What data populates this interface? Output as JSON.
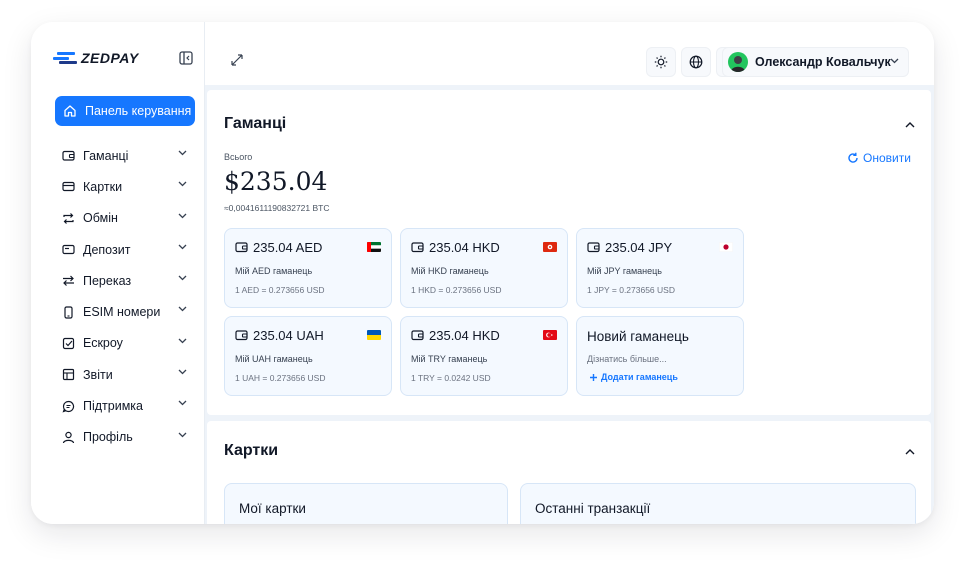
{
  "brand": {
    "name": "ZEDPAY"
  },
  "sidebar": {
    "dashboard_label": "Панель керування",
    "items": [
      {
        "label": "Гаманці",
        "icon": "wallet-icon"
      },
      {
        "label": "Картки",
        "icon": "card-icon"
      },
      {
        "label": "Обмін",
        "icon": "exchange-icon"
      },
      {
        "label": "Депозит",
        "icon": "deposit-icon"
      },
      {
        "label": "Переказ",
        "icon": "transfer-icon"
      },
      {
        "label": "ESIM номери",
        "icon": "esim-icon"
      },
      {
        "label": "Ескроу",
        "icon": "escrow-icon"
      },
      {
        "label": "Звіти",
        "icon": "reports-icon"
      },
      {
        "label": "Підтримка",
        "icon": "support-icon"
      },
      {
        "label": "Профіль",
        "icon": "profile-icon"
      }
    ]
  },
  "header": {
    "user_name": "Олександр Ковальчук"
  },
  "wallets": {
    "title": "Гаманці",
    "total_label": "Всього",
    "total_value": "$235.04",
    "total_btc": "≈0,004161119083272​1 BTC",
    "refresh_label": "Оновити",
    "cards": [
      {
        "amount": "235.04 AED",
        "name": "Мій AED гаманець",
        "rate": "1 AED = 0.273656 USD",
        "flag": "ae"
      },
      {
        "amount": "235.04 HKD",
        "name": "Мій HKD гаманець",
        "rate": "1 HKD = 0.273656 USD",
        "flag": "hk"
      },
      {
        "amount": "235.04 JPY",
        "name": "Мій JPY гаманець",
        "rate": "1 JPY = 0.273656 USD",
        "flag": "jp"
      },
      {
        "amount": "235.04 UAH",
        "name": "Мій UAH гаманець",
        "rate": "1 UAH = 0.273656 USD",
        "flag": "ua"
      },
      {
        "amount": "235.04 HKD",
        "name": "Мій TRY гаманець",
        "rate": "1 TRY = 0.0242 USD",
        "flag": "tr"
      }
    ],
    "new_wallet": {
      "title": "Новий гаманець",
      "learn_more": "Дізнатись більше...",
      "add_label": "Додати гаманець"
    }
  },
  "cards_section": {
    "title": "Картки",
    "my_cards": "Мої картки",
    "recent_transactions": "Останні транзакції"
  },
  "colors": {
    "accent": "#1677ff",
    "card_bg": "#f4f9ff",
    "card_border": "#d7e6f7",
    "page_bg": "#eef3f9"
  }
}
